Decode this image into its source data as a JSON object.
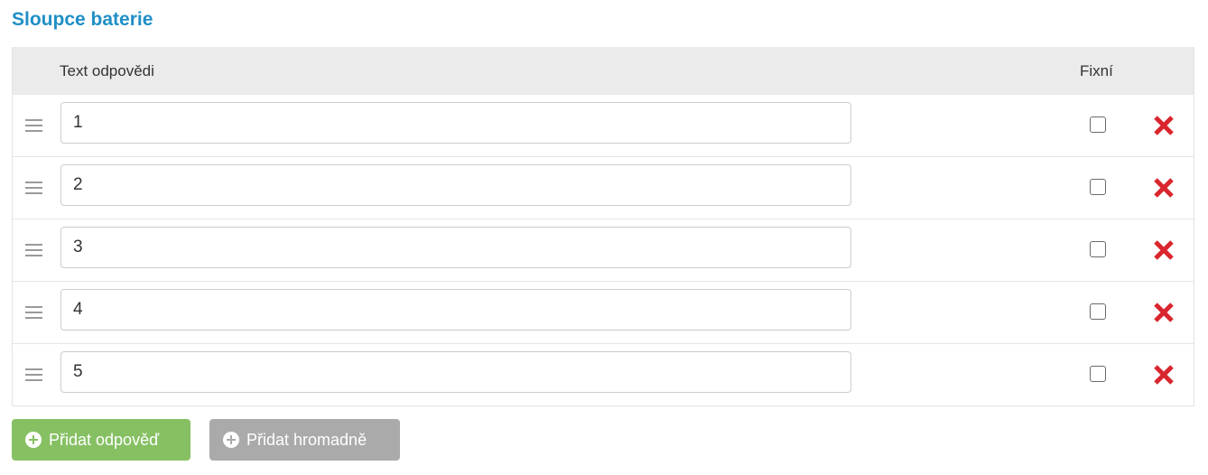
{
  "section": {
    "title": "Sloupce baterie"
  },
  "table": {
    "headers": {
      "answer_text": "Text odpovědi",
      "fixed": "Fixní"
    },
    "rows": [
      {
        "value": "1",
        "fixed": false
      },
      {
        "value": "2",
        "fixed": false
      },
      {
        "value": "3",
        "fixed": false
      },
      {
        "value": "4",
        "fixed": false
      },
      {
        "value": "5",
        "fixed": false
      }
    ]
  },
  "buttons": {
    "add_answer": "Přidat odpověď",
    "add_bulk": "Přidat hromadně"
  },
  "colors": {
    "title": "#1f8fc6",
    "add_button": "#86c063",
    "bulk_button": "#aaaaaa",
    "delete_icon": "#d9262e"
  },
  "icons": {
    "drag": "drag-handle-icon",
    "delete": "delete-x-icon",
    "add": "plus-circle-icon"
  }
}
